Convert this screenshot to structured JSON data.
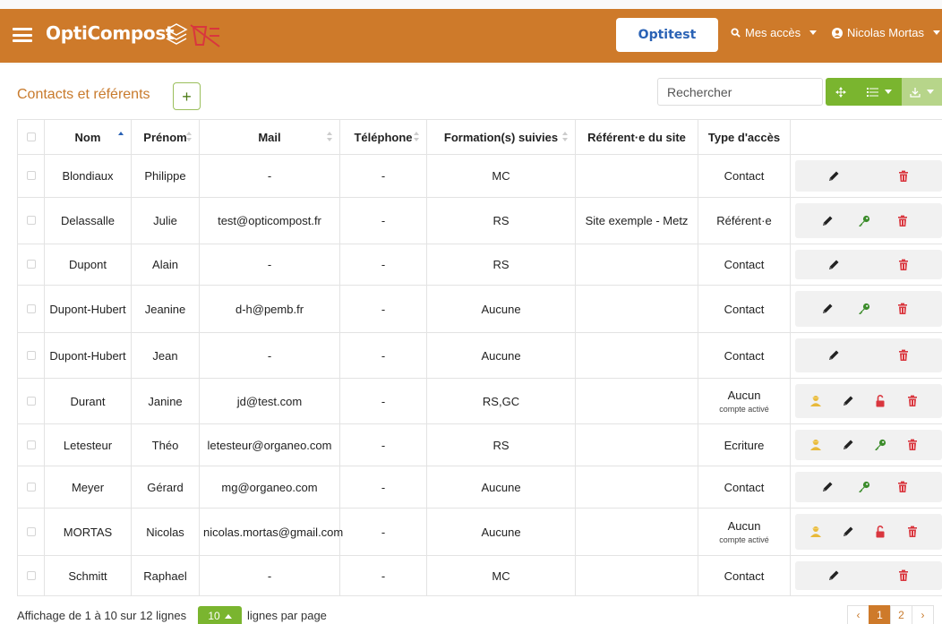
{
  "navbar": {
    "brand": "OptiCompost",
    "optitest_label": "Optitest",
    "mes_acces_label": "Mes accès",
    "user_name": "Nicolas Mortas"
  },
  "toolbar": {
    "title": "Contacts et référents",
    "add_label": "+",
    "search_placeholder": "Rechercher"
  },
  "colors": {
    "primary_orange": "#ce7a2a",
    "green": "#7ab52f",
    "danger_red": "#d9363e",
    "key_green": "#3b8c2a",
    "user_yellow": "#e8b93a",
    "link_blue": "#2a62b5"
  },
  "table": {
    "columns": [
      "Nom",
      "Prénom",
      "Mail",
      "Téléphone",
      "Formation(s) suivies",
      "Référent·e du site",
      "Type d'accès"
    ],
    "rows": [
      {
        "nom": "Blondiaux",
        "prenom": "Philippe",
        "mail": "-",
        "tel": "-",
        "formation": "MC",
        "referent": "",
        "type": "Contact",
        "type_sub": "",
        "actions": [
          "edit-icon",
          "trash-icon"
        ]
      },
      {
        "nom": "Delassalle",
        "prenom": "Julie",
        "mail": "test@opticompost.fr",
        "tel": "-",
        "formation": "RS",
        "referent": "Site exemple - Metz",
        "type": "Référent·e",
        "type_sub": "",
        "actions": [
          "edit-icon",
          "key-icon",
          "trash-icon"
        ]
      },
      {
        "nom": "Dupont",
        "prenom": "Alain",
        "mail": "-",
        "tel": "-",
        "formation": "RS",
        "referent": "",
        "type": "Contact",
        "type_sub": "",
        "actions": [
          "edit-icon",
          "trash-icon"
        ]
      },
      {
        "nom": "Dupont-Hubert",
        "prenom": "Jeanine",
        "mail": "d-h@pemb.fr",
        "tel": "-",
        "formation": "Aucune",
        "referent": "",
        "type": "Contact",
        "type_sub": "",
        "actions": [
          "edit-icon",
          "key-icon",
          "trash-icon"
        ]
      },
      {
        "nom": "Dupont-Hubert",
        "prenom": "Jean",
        "mail": "-",
        "tel": "-",
        "formation": "Aucune",
        "referent": "",
        "type": "Contact",
        "type_sub": "",
        "actions": [
          "edit-icon",
          "trash-icon"
        ]
      },
      {
        "nom": "Durant",
        "prenom": "Janine",
        "mail": "jd@test.com",
        "tel": "-",
        "formation": "RS,GC",
        "referent": "",
        "type": "Aucun",
        "type_sub": "compte activé",
        "actions": [
          "user-icon",
          "edit-icon",
          "unlock-icon",
          "trash-icon"
        ]
      },
      {
        "nom": "Letesteur",
        "prenom": "Théo",
        "mail": "letesteur@organeo.com",
        "tel": "-",
        "formation": "RS",
        "referent": "",
        "type": "Ecriture",
        "type_sub": "",
        "actions": [
          "user-icon",
          "edit-icon",
          "key-icon",
          "trash-icon"
        ]
      },
      {
        "nom": "Meyer",
        "prenom": "Gérard",
        "mail": "mg@organeo.com",
        "tel": "-",
        "formation": "Aucune",
        "referent": "",
        "type": "Contact",
        "type_sub": "",
        "actions": [
          "edit-icon",
          "key-icon",
          "trash-icon"
        ]
      },
      {
        "nom": "MORTAS",
        "prenom": "Nicolas",
        "mail": "nicolas.mortas@gmail.com",
        "tel": "-",
        "formation": "Aucune",
        "referent": "",
        "type": "Aucun",
        "type_sub": "compte activé",
        "actions": [
          "user-icon",
          "edit-icon",
          "unlock-icon",
          "trash-icon"
        ]
      },
      {
        "nom": "Schmitt",
        "prenom": "Raphael",
        "mail": "-",
        "tel": "-",
        "formation": "MC",
        "referent": "",
        "type": "Contact",
        "type_sub": "",
        "actions": [
          "edit-icon",
          "trash-icon"
        ]
      }
    ]
  },
  "footer": {
    "info": "Affichage de 1 à 10 sur 12 lignes",
    "page_size": "10",
    "per_page_label": "lignes par page",
    "pages": [
      "‹",
      "1",
      "2",
      "›"
    ],
    "current_page": "1"
  }
}
